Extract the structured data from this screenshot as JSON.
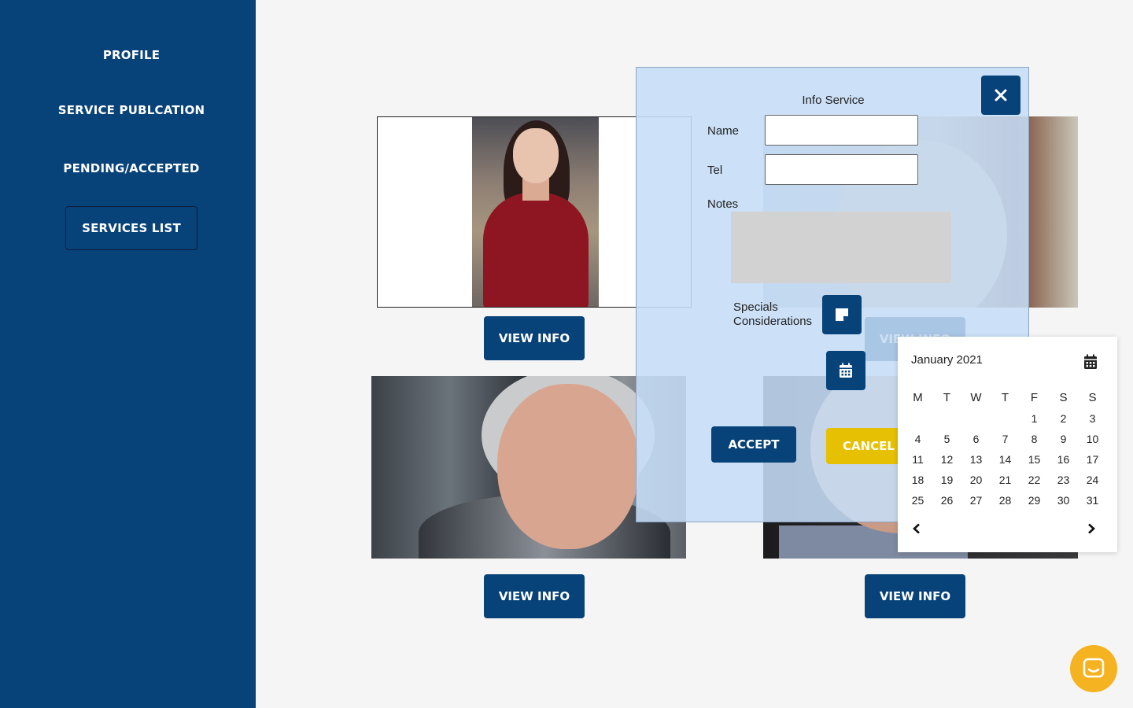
{
  "sidebar": {
    "items": [
      {
        "label": "PROFILE"
      },
      {
        "label": "SERVICE PUBLCATION"
      },
      {
        "label": "PENDING/ACCEPTED"
      },
      {
        "label": "SERVICES LIST",
        "active": true
      }
    ],
    "color": "#074279"
  },
  "cards": [
    {
      "button_label": "VIEW INFO"
    },
    {
      "button_label": "VIEW INFO"
    },
    {
      "button_label": "VIEW INFO"
    },
    {
      "button_label": "VIEW INFO"
    }
  ],
  "modal": {
    "title": "Info Service",
    "close_icon": "close-icon",
    "name_label": "Name",
    "name_value": "",
    "tel_label": "Tel",
    "tel_value": "",
    "notes_label": "Notes",
    "specials_label": "Specials Considerations",
    "accept_label": "ACCEPT",
    "cancel_label": "CANCEL",
    "accent": "#074279",
    "cancel_color": "#e6c002"
  },
  "calendar": {
    "month_label": "January 2021",
    "weekdays": [
      "M",
      "T",
      "W",
      "T",
      "F",
      "S",
      "S"
    ],
    "weeks": [
      [
        "",
        "",
        "",
        "",
        "1",
        "2",
        "3"
      ],
      [
        "4",
        "5",
        "6",
        "7",
        "8",
        "9",
        "10"
      ],
      [
        "11",
        "12",
        "13",
        "14",
        "15",
        "16",
        "17"
      ],
      [
        "18",
        "19",
        "20",
        "21",
        "22",
        "23",
        "24"
      ],
      [
        "25",
        "26",
        "27",
        "28",
        "29",
        "30",
        "31"
      ]
    ]
  },
  "chat": {
    "icon": "chat-icon",
    "color": "#f5b321"
  }
}
